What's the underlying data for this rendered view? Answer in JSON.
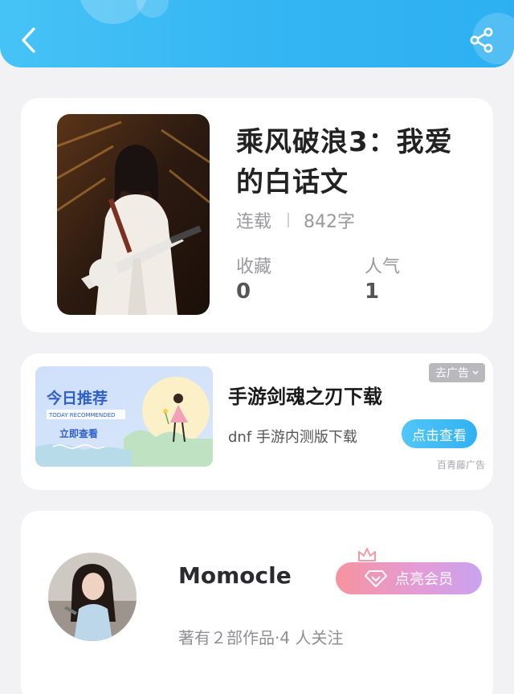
{
  "header": {
    "back_icon": "chevron-left-icon",
    "share_icon": "share-icon",
    "accent_color": "#35b6f3"
  },
  "book": {
    "title": "乘风破浪3：我爱的白话文",
    "status": "连载",
    "word_count": "842字",
    "favorites_label": "收藏",
    "favorites_value": "0",
    "popularity_label": "人气",
    "popularity_value": "1"
  },
  "ad": {
    "remove_label": "去广告",
    "title": "手游剑魂之刃下载",
    "subtitle": "dnf 手游内测版下载",
    "cta_label": "点击查看",
    "source": "百青藤广告",
    "banner": {
      "headline": "今日推荐",
      "tagline": "TODAY RECOMMENDED",
      "button": "立即查看"
    }
  },
  "author": {
    "name": "Momocle",
    "stats": "著有２部作品·4 人关注",
    "vip_label": "点亮会员"
  }
}
